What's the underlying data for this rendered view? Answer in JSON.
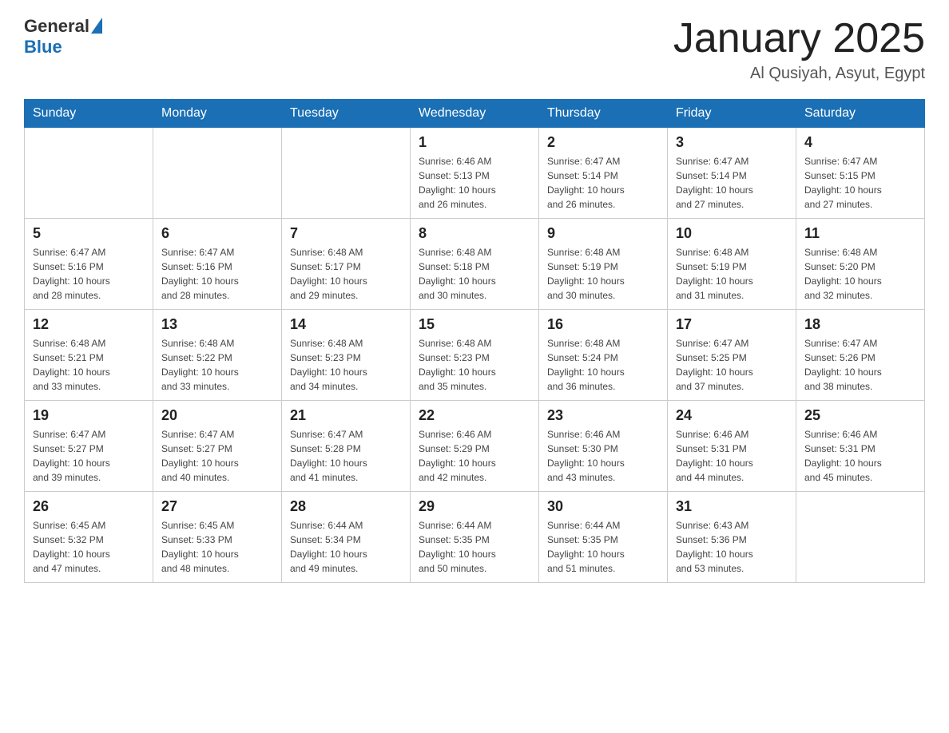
{
  "header": {
    "logo": {
      "text_general": "General",
      "text_blue": "Blue"
    },
    "title": "January 2025",
    "location": "Al Qusiyah, Asyut, Egypt"
  },
  "days_of_week": [
    "Sunday",
    "Monday",
    "Tuesday",
    "Wednesday",
    "Thursday",
    "Friday",
    "Saturday"
  ],
  "weeks": [
    {
      "days": [
        {
          "number": "",
          "info": ""
        },
        {
          "number": "",
          "info": ""
        },
        {
          "number": "",
          "info": ""
        },
        {
          "number": "1",
          "info": "Sunrise: 6:46 AM\nSunset: 5:13 PM\nDaylight: 10 hours\nand 26 minutes."
        },
        {
          "number": "2",
          "info": "Sunrise: 6:47 AM\nSunset: 5:14 PM\nDaylight: 10 hours\nand 26 minutes."
        },
        {
          "number": "3",
          "info": "Sunrise: 6:47 AM\nSunset: 5:14 PM\nDaylight: 10 hours\nand 27 minutes."
        },
        {
          "number": "4",
          "info": "Sunrise: 6:47 AM\nSunset: 5:15 PM\nDaylight: 10 hours\nand 27 minutes."
        }
      ]
    },
    {
      "days": [
        {
          "number": "5",
          "info": "Sunrise: 6:47 AM\nSunset: 5:16 PM\nDaylight: 10 hours\nand 28 minutes."
        },
        {
          "number": "6",
          "info": "Sunrise: 6:47 AM\nSunset: 5:16 PM\nDaylight: 10 hours\nand 28 minutes."
        },
        {
          "number": "7",
          "info": "Sunrise: 6:48 AM\nSunset: 5:17 PM\nDaylight: 10 hours\nand 29 minutes."
        },
        {
          "number": "8",
          "info": "Sunrise: 6:48 AM\nSunset: 5:18 PM\nDaylight: 10 hours\nand 30 minutes."
        },
        {
          "number": "9",
          "info": "Sunrise: 6:48 AM\nSunset: 5:19 PM\nDaylight: 10 hours\nand 30 minutes."
        },
        {
          "number": "10",
          "info": "Sunrise: 6:48 AM\nSunset: 5:19 PM\nDaylight: 10 hours\nand 31 minutes."
        },
        {
          "number": "11",
          "info": "Sunrise: 6:48 AM\nSunset: 5:20 PM\nDaylight: 10 hours\nand 32 minutes."
        }
      ]
    },
    {
      "days": [
        {
          "number": "12",
          "info": "Sunrise: 6:48 AM\nSunset: 5:21 PM\nDaylight: 10 hours\nand 33 minutes."
        },
        {
          "number": "13",
          "info": "Sunrise: 6:48 AM\nSunset: 5:22 PM\nDaylight: 10 hours\nand 33 minutes."
        },
        {
          "number": "14",
          "info": "Sunrise: 6:48 AM\nSunset: 5:23 PM\nDaylight: 10 hours\nand 34 minutes."
        },
        {
          "number": "15",
          "info": "Sunrise: 6:48 AM\nSunset: 5:23 PM\nDaylight: 10 hours\nand 35 minutes."
        },
        {
          "number": "16",
          "info": "Sunrise: 6:48 AM\nSunset: 5:24 PM\nDaylight: 10 hours\nand 36 minutes."
        },
        {
          "number": "17",
          "info": "Sunrise: 6:47 AM\nSunset: 5:25 PM\nDaylight: 10 hours\nand 37 minutes."
        },
        {
          "number": "18",
          "info": "Sunrise: 6:47 AM\nSunset: 5:26 PM\nDaylight: 10 hours\nand 38 minutes."
        }
      ]
    },
    {
      "days": [
        {
          "number": "19",
          "info": "Sunrise: 6:47 AM\nSunset: 5:27 PM\nDaylight: 10 hours\nand 39 minutes."
        },
        {
          "number": "20",
          "info": "Sunrise: 6:47 AM\nSunset: 5:27 PM\nDaylight: 10 hours\nand 40 minutes."
        },
        {
          "number": "21",
          "info": "Sunrise: 6:47 AM\nSunset: 5:28 PM\nDaylight: 10 hours\nand 41 minutes."
        },
        {
          "number": "22",
          "info": "Sunrise: 6:46 AM\nSunset: 5:29 PM\nDaylight: 10 hours\nand 42 minutes."
        },
        {
          "number": "23",
          "info": "Sunrise: 6:46 AM\nSunset: 5:30 PM\nDaylight: 10 hours\nand 43 minutes."
        },
        {
          "number": "24",
          "info": "Sunrise: 6:46 AM\nSunset: 5:31 PM\nDaylight: 10 hours\nand 44 minutes."
        },
        {
          "number": "25",
          "info": "Sunrise: 6:46 AM\nSunset: 5:31 PM\nDaylight: 10 hours\nand 45 minutes."
        }
      ]
    },
    {
      "days": [
        {
          "number": "26",
          "info": "Sunrise: 6:45 AM\nSunset: 5:32 PM\nDaylight: 10 hours\nand 47 minutes."
        },
        {
          "number": "27",
          "info": "Sunrise: 6:45 AM\nSunset: 5:33 PM\nDaylight: 10 hours\nand 48 minutes."
        },
        {
          "number": "28",
          "info": "Sunrise: 6:44 AM\nSunset: 5:34 PM\nDaylight: 10 hours\nand 49 minutes."
        },
        {
          "number": "29",
          "info": "Sunrise: 6:44 AM\nSunset: 5:35 PM\nDaylight: 10 hours\nand 50 minutes."
        },
        {
          "number": "30",
          "info": "Sunrise: 6:44 AM\nSunset: 5:35 PM\nDaylight: 10 hours\nand 51 minutes."
        },
        {
          "number": "31",
          "info": "Sunrise: 6:43 AM\nSunset: 5:36 PM\nDaylight: 10 hours\nand 53 minutes."
        },
        {
          "number": "",
          "info": ""
        }
      ]
    }
  ]
}
